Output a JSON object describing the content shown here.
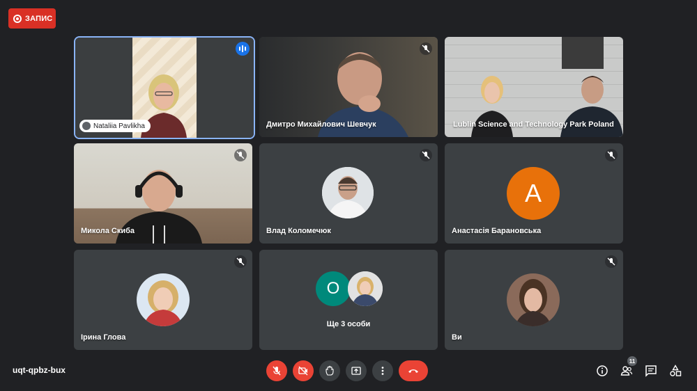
{
  "recording": {
    "label": "ЗАПИС"
  },
  "tiles": [
    {
      "name": "Nataliia Pavlikha",
      "speaking": true
    },
    {
      "name": "Дмитро Михайлович Шевчук",
      "muted": true
    },
    {
      "name": "Lublin Science and Technology Park Poland",
      "muted": false
    },
    {
      "name": "Микола Скиба",
      "muted": true
    },
    {
      "name": "Влад Коломечюк",
      "muted": true
    },
    {
      "name": "Анастасія Барановська",
      "muted": true,
      "avatar_letter": "A",
      "avatar_color": "#e8710a"
    },
    {
      "name": "Ірина Глова",
      "muted": true
    },
    {
      "label": "Ще 3 особи",
      "avatar_letter": "O",
      "avatar_color": "#00897b"
    },
    {
      "name": "Ви",
      "muted": true
    }
  ],
  "bottom_bar": {
    "meeting_code": "uqt-qpbz-bux",
    "controls": [
      "mic-off-icon",
      "camera-off-icon",
      "raise-hand-icon",
      "present-screen-icon",
      "more-options-icon",
      "end-call-icon"
    ],
    "right_icons": [
      "info-icon",
      "people-icon",
      "chat-icon",
      "activities-icon"
    ],
    "participant_count": "11"
  },
  "colors": {
    "background": "#202124",
    "tile": "#3c4043",
    "accent": "#1a73e8",
    "danger": "#ea4335"
  }
}
